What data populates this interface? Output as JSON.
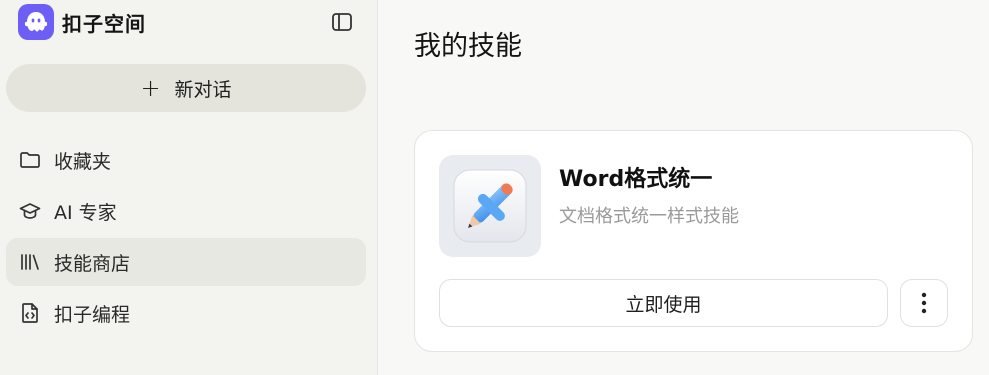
{
  "brand": {
    "name": "扣子空间",
    "logo_icon": "ghost-logo-icon",
    "accent_color": "#6d5ff5"
  },
  "sidebar": {
    "toggle_icon": "sidebar-toggle-icon",
    "new_chat_label": "新对话",
    "items": [
      {
        "label": "收藏夹",
        "icon": "folder-icon",
        "active": false
      },
      {
        "label": "AI 专家",
        "icon": "graduation-cap-icon",
        "active": false
      },
      {
        "label": "技能商店",
        "icon": "library-icon",
        "active": true
      },
      {
        "label": "扣子编程",
        "icon": "code-file-icon",
        "active": false
      }
    ]
  },
  "main": {
    "title": "我的技能",
    "skill_card": {
      "name": "Word格式统一",
      "description": "文档格式统一样式技能",
      "thumbnail_icon": "pencil-ruler-icon",
      "use_button_label": "立即使用",
      "more_icon": "more-vertical-icon"
    }
  }
}
